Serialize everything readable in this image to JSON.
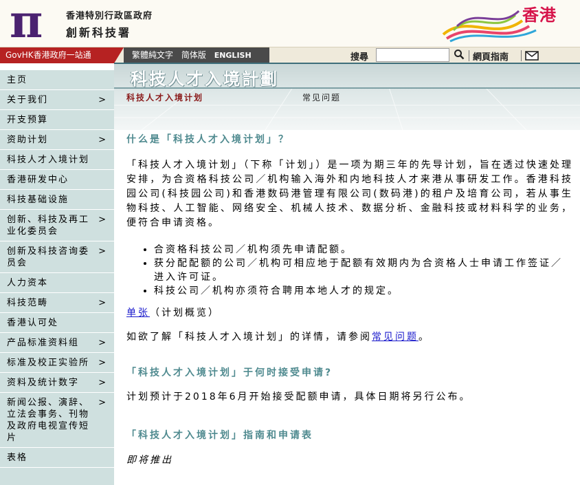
{
  "header": {
    "gov_name": "香港特別行政區政府",
    "dept_name": "創新科技署",
    "brand_text": "香港"
  },
  "nav": {
    "govhk": "GovHK香港政府一站通",
    "lang_trad": "繁體純文字",
    "lang_simp": "简体版",
    "lang_en": "ENGLISH",
    "search_label": "搜尋",
    "search_placeholder": "",
    "sitemap": "網頁指南"
  },
  "sidebar": {
    "items": [
      {
        "label": "主页",
        "chevron": ""
      },
      {
        "label": "关于我们",
        "chevron": ">"
      },
      {
        "label": "开支预算",
        "chevron": ""
      },
      {
        "label": "资助计划",
        "chevron": ">"
      },
      {
        "label": "科技人才入境计划",
        "chevron": ""
      },
      {
        "label": "香港研发中心",
        "chevron": ""
      },
      {
        "label": "科技基础设施",
        "chevron": ""
      },
      {
        "label": "创新、科技及再工业化委员会",
        "chevron": ">"
      },
      {
        "label": "创新及科技咨询委员会",
        "chevron": ">"
      },
      {
        "label": "人力资本",
        "chevron": ""
      },
      {
        "label": "科技范畴",
        "chevron": ">"
      },
      {
        "label": "香港认可处",
        "chevron": ""
      },
      {
        "label": "产品标准资料组",
        "chevron": ">"
      },
      {
        "label": "标准及校正实验所",
        "chevron": ">"
      },
      {
        "label": "资料及统计数字",
        "chevron": ">"
      },
      {
        "label": "新闻公报、演辞、立法会事务、刊物及政府电视宣传短片",
        "chevron": ">"
      },
      {
        "label": "表格",
        "chevron": ""
      }
    ]
  },
  "banner": {
    "title": "科技人才入境計劃",
    "tab_active": "科技人才入境计划",
    "tab_faq": "常见问题"
  },
  "content": {
    "heading1": "什么是「科技人才入境计划」？",
    "para1": "「科技人才入境计划」（下称「计划」）是一项为期三年的先导计划，旨在透过快速处理安排，为合资格科技公司／机构输入海外和内地科技人才来港从事研发工作。香港科技园公司(科技园公司)和香港数码港管理有限公司(数码港)的租户及培育公司，若从事生物科技、人工智能、网络安全、机械人技术、数据分析、金融科技或材料科学的业务，便符合申请资格。",
    "bullets": [
      "合资格科技公司／机构须先申请配额。",
      "获分配配额的公司／机构可相应地于配额有效期内为合资格人士申请工作签证／进入许可证。",
      "科技公司／机构亦须符合聘用本地人才的规定。"
    ],
    "leaflet_link": "单张",
    "leaflet_note": "（计划概览）",
    "faq_prefix": "如欲了解「科技人才入境计划」的详情，请参阅",
    "faq_link": "常见问题",
    "faq_suffix": "。",
    "heading2": "「科技人才入境计划」于何时接受申请?",
    "para2": "计划预计于2018年6月开始接受配额申请，具体日期将另行公布。",
    "heading3": "「科技人才入境计划」指南和申请表",
    "coming_soon": "即将推出"
  },
  "colors": {
    "govhk_red": "#b62222",
    "heading_teal": "#4f8a8f",
    "sidebar_bg": "#cfe0df",
    "logo_purple": "#4b2270",
    "brand_pink": "#d6144a"
  },
  "icons": [
    "pi-logo-icon",
    "hong-kong-brand-icon",
    "search-icon",
    "mail-icon",
    "chevron-right-icon"
  ]
}
